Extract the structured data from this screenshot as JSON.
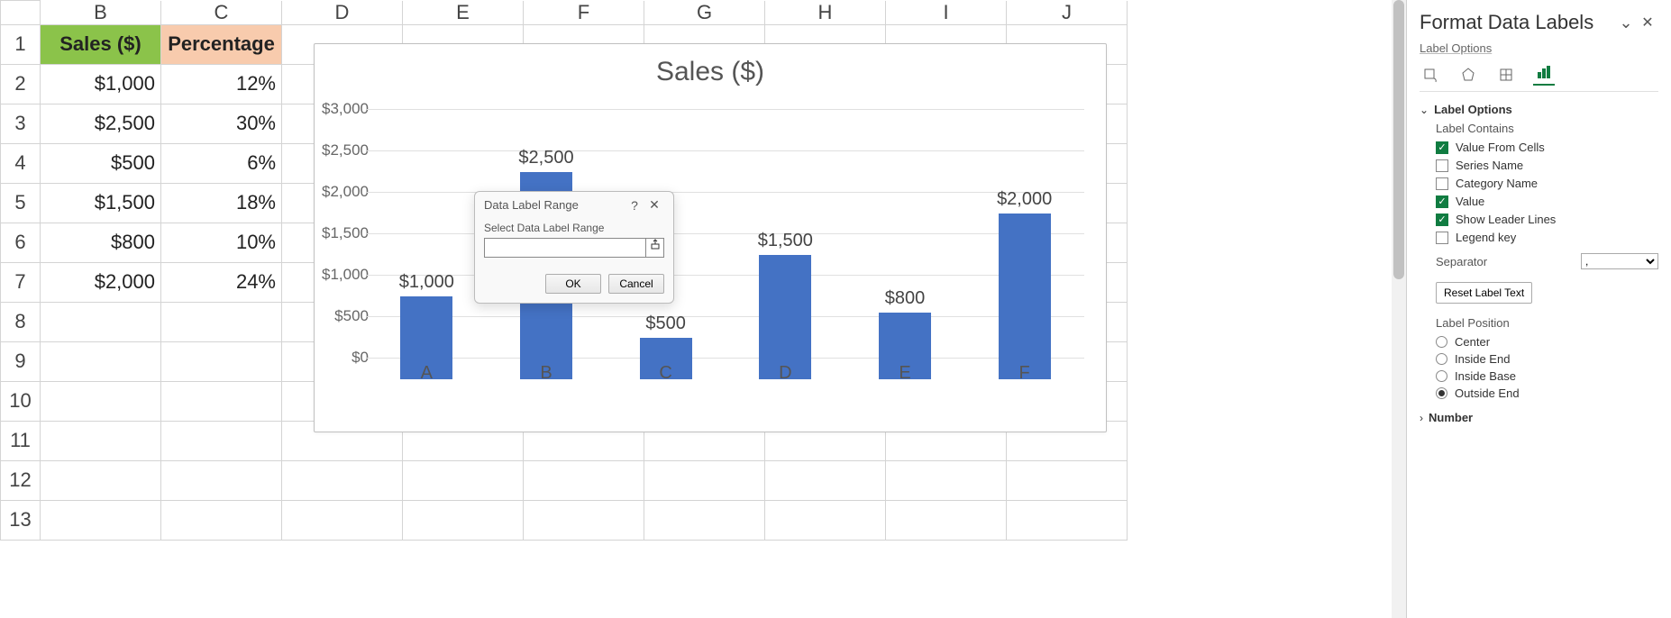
{
  "columns": [
    "B",
    "C",
    "D",
    "E",
    "F",
    "G",
    "H",
    "I",
    "J"
  ],
  "rows": [
    "1",
    "2",
    "3",
    "4",
    "5",
    "6",
    "7",
    "8",
    "9",
    "10",
    "11",
    "12",
    "13"
  ],
  "headers": {
    "sales": "Sales ($)",
    "pct": "Percentage"
  },
  "cells": {
    "B2": "$1,000",
    "C2": "12%",
    "B3": "$2,500",
    "C3": "30%",
    "B4": "$500",
    "C4": "6%",
    "B5": "$1,500",
    "C5": "18%",
    "B6": "$800",
    "C6": "10%",
    "B7": "$2,000",
    "C7": "24%"
  },
  "chart_data": {
    "type": "bar",
    "title": "Sales ($)",
    "categories": [
      "A",
      "B",
      "C",
      "D",
      "E",
      "F"
    ],
    "values": [
      1000,
      2500,
      500,
      1500,
      800,
      2000
    ],
    "labels": [
      "$1,000",
      "$2,500",
      "$500",
      "$1,500",
      "$800",
      "$2,000"
    ],
    "yticks_values": [
      0,
      500,
      1000,
      1500,
      2000,
      2500,
      3000
    ],
    "yticks": [
      "$0",
      "$500",
      "$1,000",
      "$1,500",
      "$2,000",
      "$2,500",
      "$3,000"
    ],
    "ylim": [
      0,
      3000
    ]
  },
  "dialog": {
    "title": "Data Label Range",
    "help": "?",
    "label": "Select Data Label Range",
    "value": "",
    "ok": "OK",
    "cancel": "Cancel"
  },
  "pane": {
    "title": "Format Data Labels",
    "sub": "Label Options",
    "sec_label_options": "Label Options",
    "label_contains": "Label Contains",
    "chk_value_from_cells": "Value From Cells",
    "chk_series_name": "Series Name",
    "chk_category_name": "Category Name",
    "chk_value": "Value",
    "chk_leader": "Show Leader Lines",
    "chk_legend": "Legend key",
    "separator_label": "Separator",
    "separator_value": ",",
    "reset": "Reset Label Text",
    "label_position": "Label Position",
    "pos_center": "Center",
    "pos_inside_end": "Inside End",
    "pos_inside_base": "Inside Base",
    "pos_outside_end": "Outside End",
    "sec_number": "Number"
  }
}
